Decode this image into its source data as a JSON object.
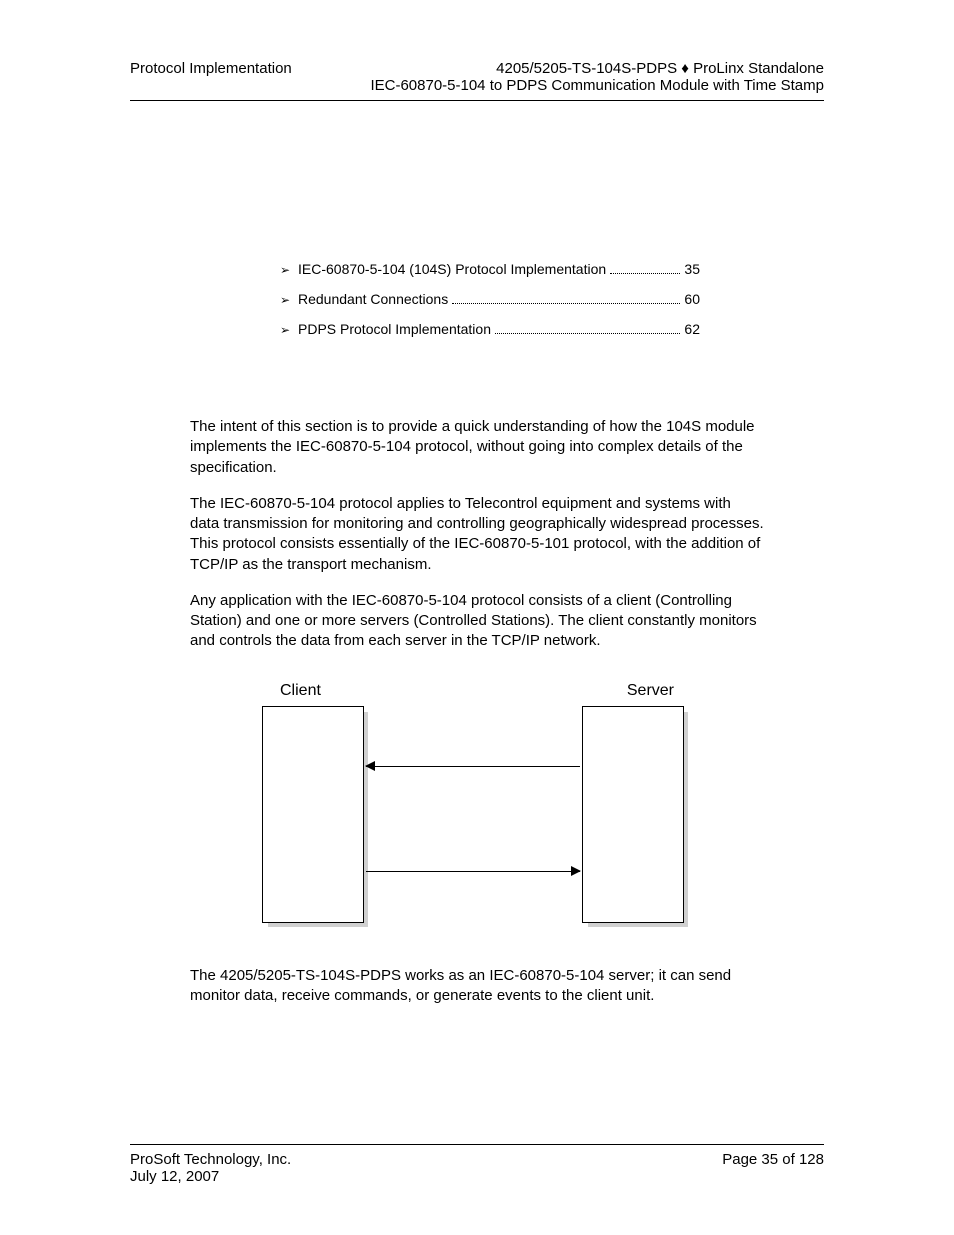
{
  "header": {
    "left": "Protocol Implementation",
    "right_line1": "4205/5205-TS-104S-PDPS ♦ ProLinx Standalone",
    "right_line2": "IEC-60870-5-104 to PDPS Communication Module with Time Stamp"
  },
  "toc": [
    {
      "label": "IEC-60870-5-104 (104S) Protocol Implementation",
      "page": "35"
    },
    {
      "label": "Redundant Connections",
      "page": "60"
    },
    {
      "label": "PDPS Protocol Implementation",
      "page": "62"
    }
  ],
  "paragraphs": {
    "p1": "The intent of this section is to provide a quick understanding of how the 104S module implements the IEC-60870-5-104 protocol, without going into complex details of the specification.",
    "p2": "The IEC-60870-5-104 protocol applies to Telecontrol equipment and systems with data transmission for monitoring and controlling geographically widespread processes. This protocol consists essentially of the IEC-60870-5-101 protocol, with the addition of TCP/IP as the transport mechanism.",
    "p3": "Any application with the IEC-60870-5-104 protocol consists of a client (Controlling Station) and one or more servers (Controlled Stations). The client constantly monitors and controls the data from each server in the TCP/IP network.",
    "p4": "The 4205/5205-TS-104S-PDPS works as an IEC-60870-5-104 server; it can send monitor data, receive commands, or generate events to the client unit."
  },
  "diagram": {
    "client_label": "Client",
    "server_label": "Server"
  },
  "footer": {
    "company": "ProSoft Technology, Inc.",
    "date": "July 12, 2007",
    "page": "Page 35 of 128"
  },
  "bullet_glyph": "➢"
}
